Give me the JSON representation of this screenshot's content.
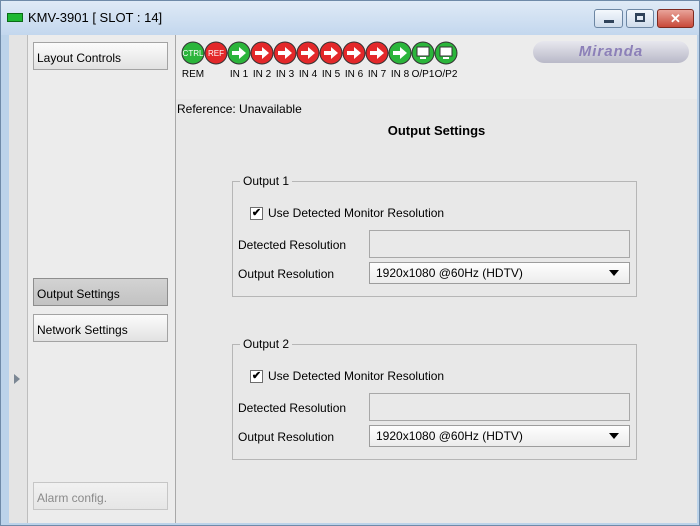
{
  "window": {
    "title": "KMV-3901 [ SLOT : 14]",
    "close_glyph": "✕"
  },
  "sidebar": {
    "items": [
      {
        "label": "Layout Controls"
      },
      {
        "label": "Output Settings"
      },
      {
        "label": "Network Settings"
      },
      {
        "label": "Alarm config."
      }
    ]
  },
  "status": {
    "icons": [
      {
        "text": "CTRL",
        "label": "REM",
        "color": "#2bb53b",
        "kind": "badge"
      },
      {
        "text": "REF",
        "label": "",
        "color": "#e3282a",
        "kind": "badge"
      },
      {
        "label": "IN 1",
        "color": "#2bb53b",
        "kind": "arrow"
      },
      {
        "label": "IN 2",
        "color": "#e3282a",
        "kind": "arrow"
      },
      {
        "label": "IN 3",
        "color": "#e3282a",
        "kind": "arrow"
      },
      {
        "label": "IN 4",
        "color": "#e3282a",
        "kind": "arrow"
      },
      {
        "label": "IN 5",
        "color": "#e3282a",
        "kind": "arrow"
      },
      {
        "label": "IN 6",
        "color": "#e3282a",
        "kind": "arrow"
      },
      {
        "label": "IN 7",
        "color": "#e3282a",
        "kind": "arrow"
      },
      {
        "label": "IN 8",
        "color": "#2bb53b",
        "kind": "arrow"
      },
      {
        "label": "O/P1",
        "color": "#2bb53b",
        "kind": "monitor"
      },
      {
        "label": "O/P2",
        "color": "#2bb53b",
        "kind": "monitor"
      }
    ],
    "brand": "Miranda"
  },
  "main": {
    "reference": "Reference: Unavailable",
    "title": "Output Settings",
    "outputs": [
      {
        "legend": "Output 1",
        "checkbox_label": "Use Detected Monitor Resolution",
        "checked": true,
        "checkmark": "✔",
        "detected_label": "Detected Resolution",
        "detected_value": "",
        "resolution_label": "Output Resolution",
        "resolution_value": "1920x1080 @60Hz (HDTV)"
      },
      {
        "legend": "Output 2",
        "checkbox_label": "Use Detected Monitor Resolution",
        "checked": true,
        "checkmark": "✔",
        "detected_label": "Detected Resolution",
        "detected_value": "",
        "resolution_label": "Output Resolution",
        "resolution_value": "1920x1080 @60Hz (HDTV)"
      }
    ]
  }
}
